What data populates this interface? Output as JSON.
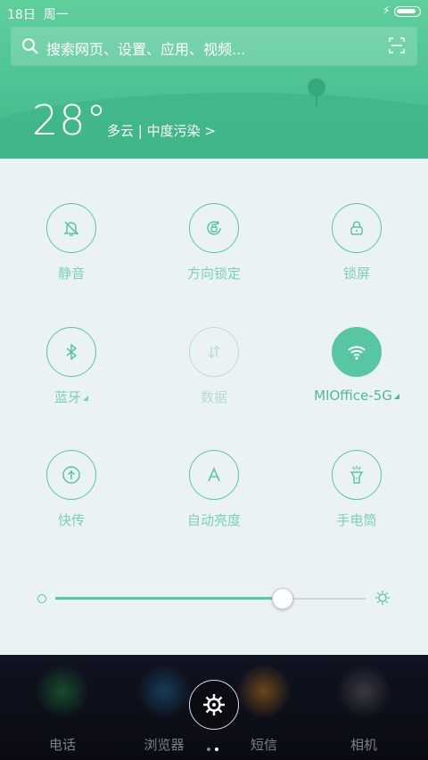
{
  "status_bar": {
    "date": "18日",
    "weekday": "周一",
    "battery_level": 0.9
  },
  "search": {
    "placeholder": "搜索网页、设置、应用、视频..."
  },
  "weather": {
    "temperature": "28°",
    "description": "多云 | 中度污染 >"
  },
  "toggles": [
    {
      "label": "静音",
      "icon": "bell-mute-icon",
      "state": "off"
    },
    {
      "label": "方向锁定",
      "icon": "rotation-lock-icon",
      "state": "off"
    },
    {
      "label": "锁屏",
      "icon": "lock-icon",
      "state": "off"
    },
    {
      "label": "蓝牙",
      "icon": "bluetooth-icon",
      "state": "off"
    },
    {
      "label": "数据",
      "icon": "mobile-data-icon",
      "state": "disabled"
    },
    {
      "label": "MIOffice-5G",
      "icon": "wifi-icon",
      "state": "on"
    },
    {
      "label": "快传",
      "icon": "share-transfer-icon",
      "state": "off"
    },
    {
      "label": "自动亮度",
      "icon": "auto-brightness-icon",
      "state": "off"
    },
    {
      "label": "手电筒",
      "icon": "flashlight-icon",
      "state": "off"
    }
  ],
  "brightness": {
    "level": 0.73
  },
  "dock": {
    "apps": [
      {
        "label": "电话",
        "icon": "phone-icon",
        "color": "#1f7a3a"
      },
      {
        "label": "浏览器",
        "icon": "browser-icon",
        "color": "#1f5f8a"
      },
      {
        "label": "短信",
        "icon": "message-icon",
        "color": "#b8731a"
      },
      {
        "label": "相机",
        "icon": "camera-icon",
        "color": "#5c5c5c"
      }
    ]
  },
  "colors": {
    "accent": "#58c6a2",
    "header": "#4cc193",
    "panel": "#ebf2f3"
  }
}
